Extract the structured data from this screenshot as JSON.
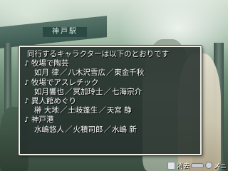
{
  "background": {
    "sign_text": "神戸駅"
  },
  "dialog": {
    "header": "同行するキャラクターは以下のとおりです",
    "note_symbol": "♪",
    "groups": [
      {
        "location": "牧場で陶芸",
        "names": [
          "如月 律",
          "八木沢雪広",
          "東金千秋"
        ]
      },
      {
        "location": "牧場でアスレチック",
        "names": [
          "如月響也",
          "冥加玲士",
          "七海宗介"
        ]
      },
      {
        "location": "異人館めぐり",
        "names": [
          "榊 大地",
          "土岐蓬生",
          "天宮 静"
        ]
      },
      {
        "location": "神戸港",
        "names": [
          "水嶋悠人",
          "火積司郎",
          "水嶋 新"
        ]
      }
    ],
    "name_separator": "／"
  },
  "hints": {
    "erase_label": "消去",
    "menu_label": "メニ"
  }
}
